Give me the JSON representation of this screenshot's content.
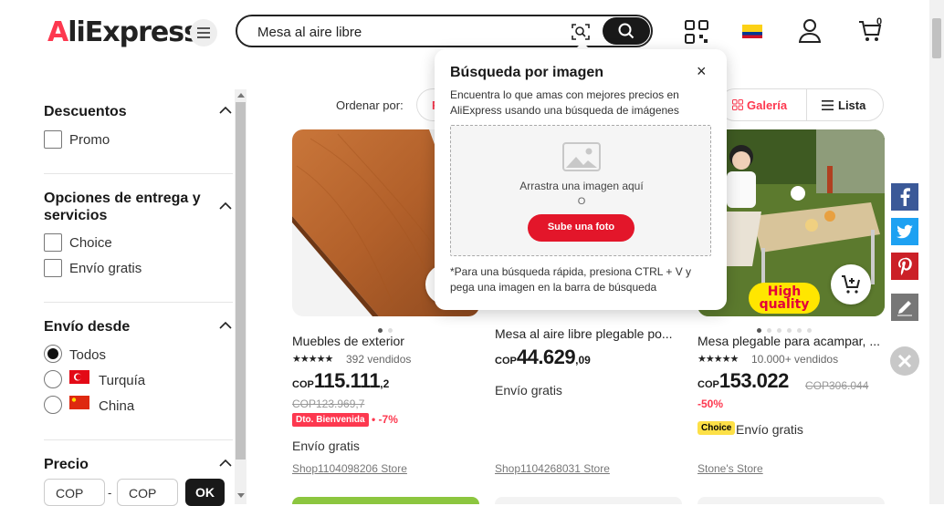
{
  "header": {
    "logo": "AliExpress",
    "search_value": "Mesa al aire libre",
    "cart_count": "0"
  },
  "sidebar": {
    "descuentos": {
      "title": "Descuentos",
      "options": [
        "Promo"
      ]
    },
    "entrega": {
      "title_line1": "Opciones de entrega y",
      "title_line2": "servicios",
      "options": [
        "Choice",
        "Envío gratis"
      ]
    },
    "envio_desde": {
      "title": "Envío desde",
      "options": [
        "Todos",
        "Turquía",
        "China"
      ],
      "selected": "Todos"
    },
    "precio": {
      "title": "Precio",
      "min_placeholder": "COP",
      "max_placeholder": "COP",
      "separator": "-",
      "ok_label": "OK"
    }
  },
  "sortbar": {
    "label": "Ordenar por:",
    "first_option_initial": "F",
    "gallery_label": "Galería",
    "list_label": "Lista"
  },
  "products": [
    {
      "title": "Muebles de exterior",
      "sold": "392 vendidos",
      "currency": "COP",
      "price_main": "115.111",
      "price_dec": ",2",
      "old_price": "COP123.969,7",
      "badge": "Dto. Bienvenida",
      "discount": "• -7%",
      "shipping": "Envío gratis",
      "store": "Shop1104098206 Store"
    },
    {
      "title": "Mesa al aire libre plegable po...",
      "currency": "COP",
      "price_main": "44.629",
      "price_dec": ",09",
      "shipping": "Envío gratis",
      "store": "Shop1104268031 Store"
    },
    {
      "title": "Mesa plegable para acampar, ...",
      "sold": "10.000+ vendidos",
      "currency": "COP",
      "price_main": "153.022",
      "old_price": "COP306.044",
      "discount": "-50%",
      "choice_badge": "Choice",
      "shipping": "Envío gratis",
      "store": "Stone's Store",
      "hq_line1": "High",
      "hq_line2": "quality"
    }
  ],
  "popup": {
    "title": "Búsqueda por imagen",
    "description": "Encuentra lo que amas con mejores precios en AliExpress usando una búsqueda de imágenes",
    "drop_text": "Arrastra una imagen aquí",
    "or_text": "O",
    "upload_label": "Sube una foto",
    "hint": "*Para una búsqueda rápida, presiona CTRL + V y pega una imagen en la barra de búsqueda",
    "close": "×"
  },
  "colors": {
    "accent": "#fd384f",
    "upload": "#e3162a",
    "choice": "#fde047"
  }
}
